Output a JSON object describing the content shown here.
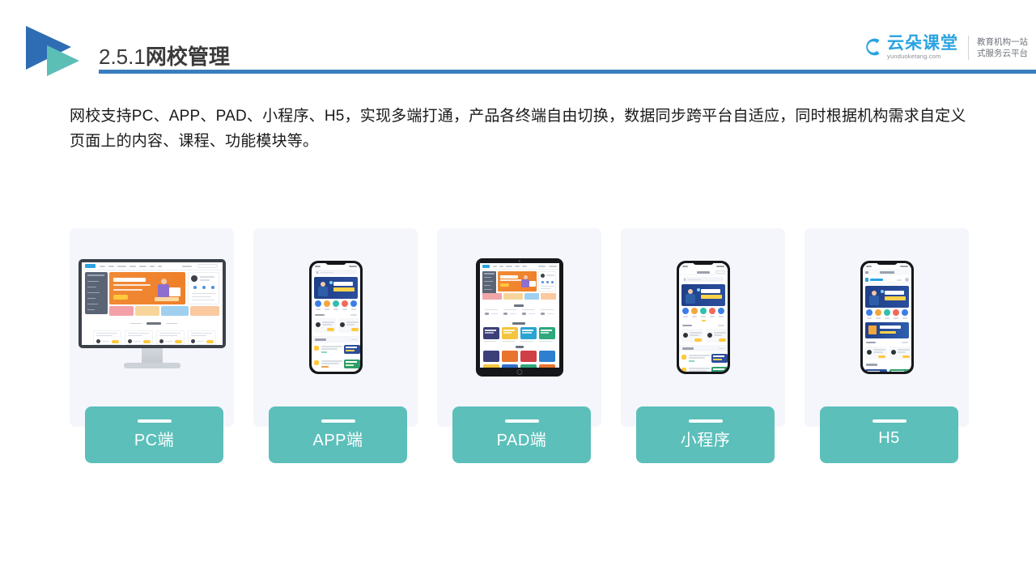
{
  "header": {
    "title_number": "2.5.1",
    "title_text": "网校管理",
    "underline_color": "#3a7dbf",
    "logo_icon": "double-triangle-play-icon",
    "logo_colors": {
      "primary": "#2e6db4",
      "secondary": "#5bbfb5"
    }
  },
  "brand": {
    "icon": "cloud-icon",
    "name_cn": "云朵课堂",
    "url": "yunduoketang.com",
    "tagline_line1": "教育机构一站",
    "tagline_line2": "式服务云平台",
    "color": "#2aa3e0"
  },
  "main": {
    "paragraph": "网校支持PC、APP、PAD、小程序、H5，实现多端打通，产品各终端自由切换，数据同步跨平台自适应，同时根据机构需求自定义页面上的内容、课程、功能模块等。"
  },
  "cards": [
    {
      "label": "PC端",
      "device": "desktop",
      "accent": "#5cbfba",
      "bg": "#f4f6fb"
    },
    {
      "label": "APP端",
      "device": "phone",
      "accent": "#5cbfba",
      "bg": "#f4f6fb"
    },
    {
      "label": "PAD端",
      "device": "tablet",
      "accent": "#5cbfba",
      "bg": "#f4f6fb"
    },
    {
      "label": "小程序",
      "device": "phone",
      "accent": "#5cbfba",
      "bg": "#f4f6fb"
    },
    {
      "label": "H5",
      "device": "phone",
      "accent": "#5cbfba",
      "bg": "#f4f6fb"
    }
  ],
  "colors": {
    "teal": "#5cbfba",
    "card_bg": "#f4f6fb",
    "blue": "#3a7dbf",
    "text": "#1a1a1a"
  }
}
